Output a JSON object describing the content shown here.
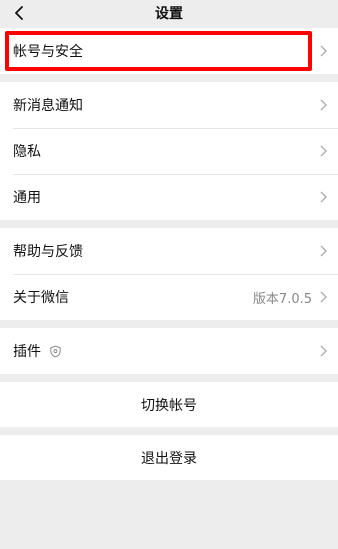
{
  "header": {
    "title": "设置"
  },
  "group1": {
    "account_label": "帐号与安全"
  },
  "group2": {
    "items": [
      {
        "label": "新消息通知"
      },
      {
        "label": "隐私"
      },
      {
        "label": "通用"
      }
    ]
  },
  "group3": {
    "help_label": "帮助与反馈",
    "about_label": "关于微信",
    "version_value": "版本7.0.5"
  },
  "group4": {
    "plugins_label": "插件"
  },
  "actions": {
    "switch_account": "切换帐号",
    "logout": "退出登录"
  },
  "colors": {
    "background": "#ededed",
    "highlight": "#ff0000",
    "secondary_text": "#888888"
  }
}
